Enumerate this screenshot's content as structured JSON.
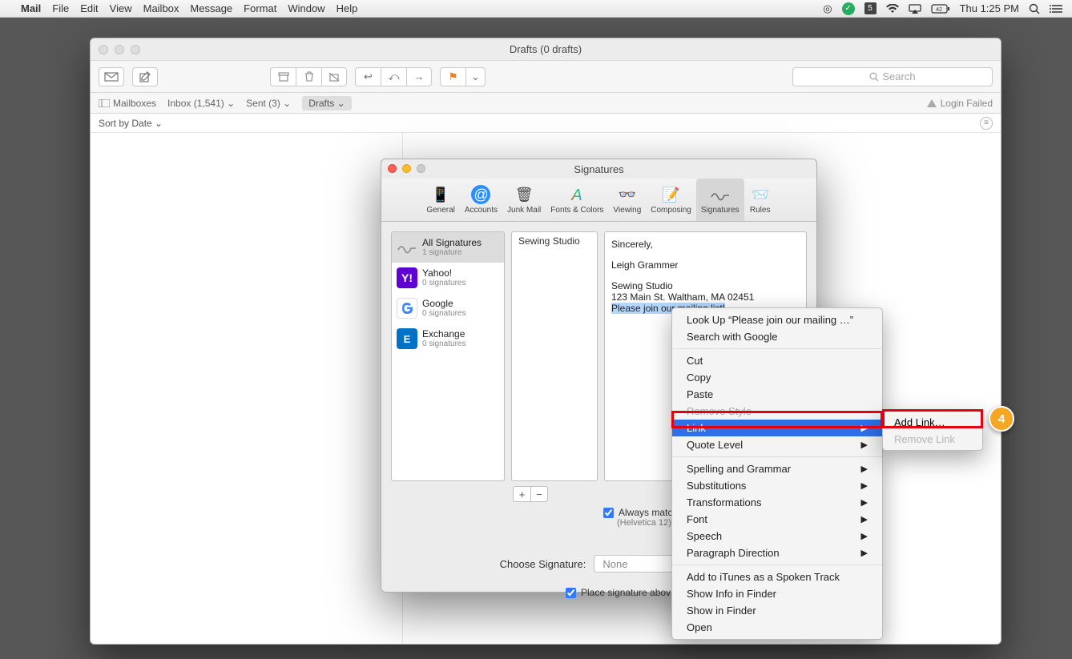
{
  "menubar": {
    "app": "Mail",
    "items": [
      "File",
      "Edit",
      "View",
      "Mailbox",
      "Message",
      "Format",
      "Window",
      "Help"
    ],
    "clock": "Thu 1:25 PM"
  },
  "mailwin": {
    "title": "Drafts (0 drafts)",
    "search_placeholder": "Search",
    "fav": {
      "mailboxes": "Mailboxes",
      "inbox": "Inbox (1,541)",
      "sent": "Sent (3)",
      "drafts": "Drafts"
    },
    "login_failed": "Login Failed",
    "sortby": "Sort by Date"
  },
  "pref": {
    "title": "Signatures",
    "tabs": [
      "General",
      "Accounts",
      "Junk Mail",
      "Fonts & Colors",
      "Viewing",
      "Composing",
      "Signatures",
      "Rules"
    ],
    "accounts": [
      {
        "name": "All Signatures",
        "sub": "1 signature"
      },
      {
        "name": "Yahoo!",
        "sub": "0 signatures"
      },
      {
        "name": "Google",
        "sub": "0 signatures"
      },
      {
        "name": "Exchange",
        "sub": "0 signatures"
      }
    ],
    "siglist": [
      "Sewing Studio"
    ],
    "sig": {
      "l1": "Sincerely,",
      "l2": "Leigh Grammer",
      "l3": "Sewing Studio",
      "l4": "123 Main St. Waltham, MA 02451",
      "l5": "Please join our mailing list!"
    },
    "always_match": "Always matc",
    "helvetica": "(Helvetica 12)",
    "choose_label": "Choose Signature:",
    "choose_value": "None",
    "place_above": "Place signature abov"
  },
  "ctx": {
    "lookup": "Look Up “Please join our mailing …”",
    "searchg": "Search with Google",
    "cut": "Cut",
    "copy": "Copy",
    "paste": "Paste",
    "removestyle": "Remove Style",
    "link": "Link",
    "quote": "Quote Level",
    "spell": "Spelling and Grammar",
    "subs": "Substitutions",
    "trans": "Transformations",
    "font": "Font",
    "speech": "Speech",
    "para": "Paragraph Direction",
    "itunes": "Add to iTunes as a Spoken Track",
    "showinfo": "Show Info in Finder",
    "showfinder": "Show in Finder",
    "open": "Open"
  },
  "sub": {
    "add": "Add Link…",
    "remove": "Remove Link"
  },
  "callout": "4"
}
